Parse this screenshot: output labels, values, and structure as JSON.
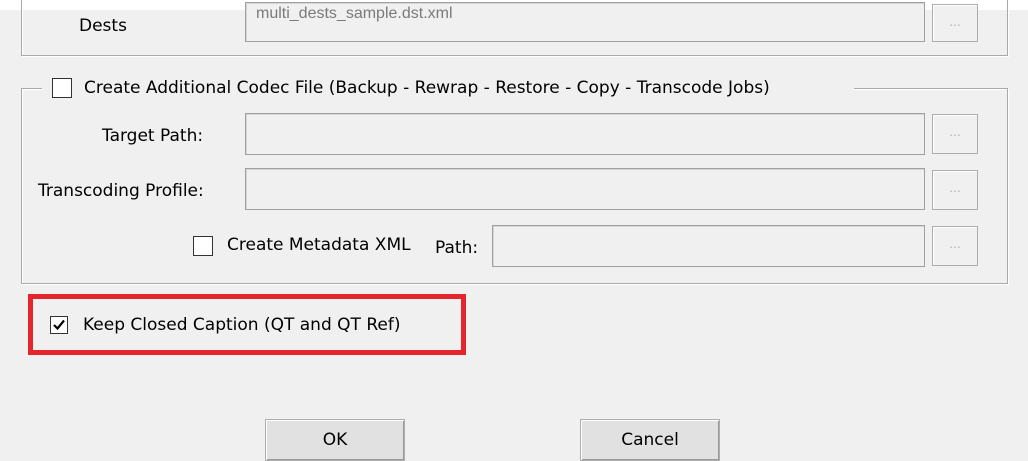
{
  "dests": {
    "label": "Dests",
    "value": "multi_dests_sample.dst.xml",
    "browse_label": "..."
  },
  "codec_group": {
    "checkbox_label": "Create Additional Codec File (Backup - Rewrap - Restore - Copy - Transcode Jobs)",
    "checked": false,
    "target_path": {
      "label": "Target Path:",
      "value": "",
      "browse_label": "..."
    },
    "transcoding_profile": {
      "label": "Transcoding Profile:",
      "value": "",
      "browse_label": "..."
    },
    "metadata": {
      "checkbox_label": "Create Metadata XML",
      "checked": false,
      "path_label": "Path:",
      "value": "",
      "browse_label": "..."
    }
  },
  "closed_caption": {
    "checkbox_label": "Keep Closed Caption (QT and QT Ref)",
    "checked": true,
    "highlight_color": "#e4262c"
  },
  "buttons": {
    "ok_label": "OK",
    "cancel_label": "Cancel"
  }
}
